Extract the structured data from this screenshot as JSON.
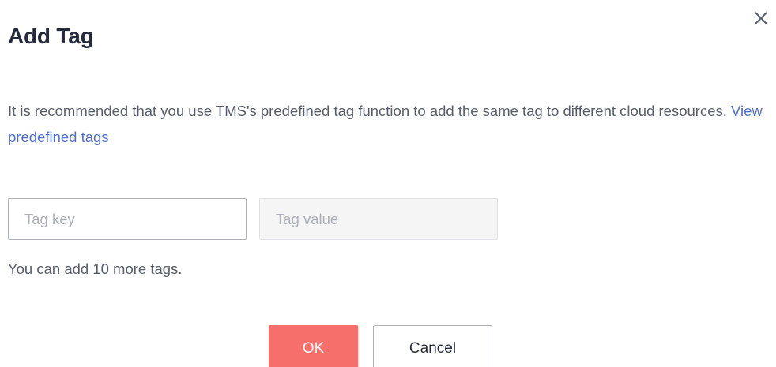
{
  "dialog": {
    "title": "Add Tag",
    "description": "It is recommended that you use TMS's predefined tag function to add the same tag to different cloud resources.",
    "link_text": "View predefined tags",
    "tag_key_placeholder": "Tag key",
    "tag_value_placeholder": "Tag value",
    "hint": "You can add 10 more tags.",
    "ok_label": "OK",
    "cancel_label": "Cancel",
    "close_icon": "close-icon"
  },
  "colors": {
    "primary_button": "#f66f6a",
    "link": "#526ecc",
    "text": "#252b3a",
    "secondary_text": "#575d6c"
  }
}
